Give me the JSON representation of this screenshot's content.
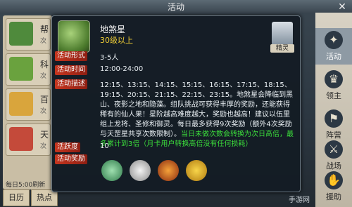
{
  "window": {
    "title": "活动"
  },
  "left_list": [
    {
      "label": "帮",
      "sub": "次"
    },
    {
      "label": "科",
      "sub": "次"
    },
    {
      "label": "百",
      "sub": "次"
    },
    {
      "label": "天",
      "sub": "次"
    }
  ],
  "bottom": {
    "daily_count": "每日5:00刷新",
    "tabs": [
      "日历",
      "热点"
    ]
  },
  "right_tabs": [
    {
      "label": "活动",
      "icon": "activity-icon"
    },
    {
      "label": "领主",
      "icon": "lord-icon"
    },
    {
      "label": "阵营",
      "icon": "camp-icon"
    },
    {
      "label": "战场",
      "icon": "battlefield-icon"
    },
    {
      "label": "援助",
      "icon": "aid-icon"
    }
  ],
  "popup": {
    "name": "地煞星",
    "level": "30级以上",
    "npc_label": "精灵",
    "rows": [
      {
        "label": "活动形式",
        "value": "3-5人"
      },
      {
        "label": "活动时间",
        "value": "12:00-24:00"
      }
    ],
    "desc_label": "活动描述",
    "desc_text": "12:15、13:15、14:15、15:15、16:15、17:15、18:15、19:15、20:15、21:15、22:15、23:15。地煞星会降临到黑山、夜影之地和隐藻。组队挑战可获得丰厚的奖励，还能获得稀有的仙人果！星阶越高难度越大，奖励也越高！建议以伍里组上龙将、圣修和御灵。每日最多获得9次奖励（额外4次奖励与天罡星共享次数限制）。",
    "desc_green": "当日未做次数会转换为次日高倍，最多累计到3倍（月卡用户转换高倍没有任何损耗）",
    "activity_label": "活跃度",
    "activity_value": "10",
    "reward_label": "活动奖励"
  },
  "watermark": "手游网"
}
